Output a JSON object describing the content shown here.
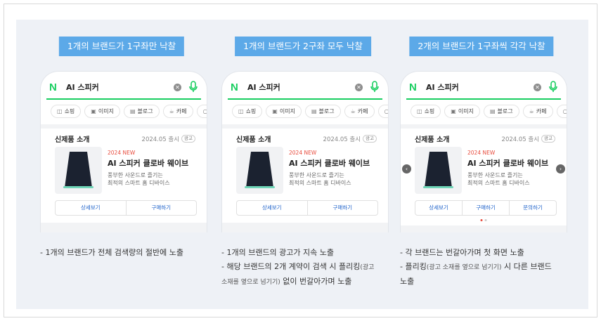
{
  "columns": [
    {
      "tag": "1개의 브랜드가 1구좌만 낙찰",
      "search_query": "AI 스피커",
      "chips": [
        "쇼핑",
        "이미지",
        "블로그",
        "카페",
        "지"
      ],
      "card_title": "신제품 소개",
      "card_date": "2024.05 출시",
      "ad_badge": "광고",
      "product_new": "2024 NEW",
      "product_name": "AI 스피커 클로바 웨이브",
      "product_desc_1": "풍부한 사운드로 즐기는",
      "product_desc_2": "최적의 스마트 홈 디바이스",
      "buttons": [
        "상세보기",
        "구매하기"
      ],
      "notes": [
        "- 1개의 브랜드가 전체 검색량의 절반에 노출"
      ]
    },
    {
      "tag": "1개의 브랜드가 2구좌 모두 낙찰",
      "search_query": "AI 스피커",
      "chips": [
        "쇼핑",
        "이미지",
        "블로그",
        "카페",
        "지"
      ],
      "card_title": "신제품 소개",
      "card_date": "2024.05 출시",
      "ad_badge": "광고",
      "product_new": "2024 NEW",
      "product_name": "AI 스피커 클로바 웨이브",
      "product_desc_1": "풍부한 사운드로 즐기는",
      "product_desc_2": "최적의 스마트 홈 디바이스",
      "buttons": [
        "상세보기",
        "구매하기"
      ],
      "notes": [
        "- 1개의 브랜드의 광고가 지속 노출",
        "- 해당 브랜드의 2개 계약이 검색 시 플리킹",
        "(광고",
        "소재를 옆으로 넘기기)",
        " 없이 번갈아가며 노출"
      ]
    },
    {
      "tag": "2개의 브랜드가 1구좌씩 각각 낙찰",
      "search_query": "AI 스피커",
      "chips": [
        "쇼핑",
        "이미지",
        "블로그",
        "카페",
        "지"
      ],
      "card_title": "신제품 소개",
      "card_date": "2024.05 출시",
      "ad_badge": "광고",
      "product_new": "2024 NEW",
      "product_name": "AI 스피커 클로바 웨이브",
      "product_desc_1": "풍부한 사운드로 즐기는",
      "product_desc_2": "최적의 스마트 홈 디바이스",
      "buttons": [
        "상세보기",
        "구매하기",
        "문의하기"
      ],
      "notes": [
        "- 각 브랜드는 번갈아가며 첫 화면 노출",
        "- 플리킹",
        "(광고 소재를 옆으로 넘기기)",
        " 시 다른 브랜드",
        "노출"
      ]
    }
  ],
  "icons": {
    "chip_icons": [
      "bag-icon",
      "image-icon",
      "blog-icon",
      "cafe-icon",
      "search-icon"
    ],
    "clear": "✕",
    "arrow_left": "‹",
    "arrow_right": "›"
  },
  "colors": {
    "tag_bg": "#5ca9e8",
    "naver_green": "#19ce60",
    "new_red": "#e84b3c",
    "button_blue": "#1a5fc9"
  }
}
